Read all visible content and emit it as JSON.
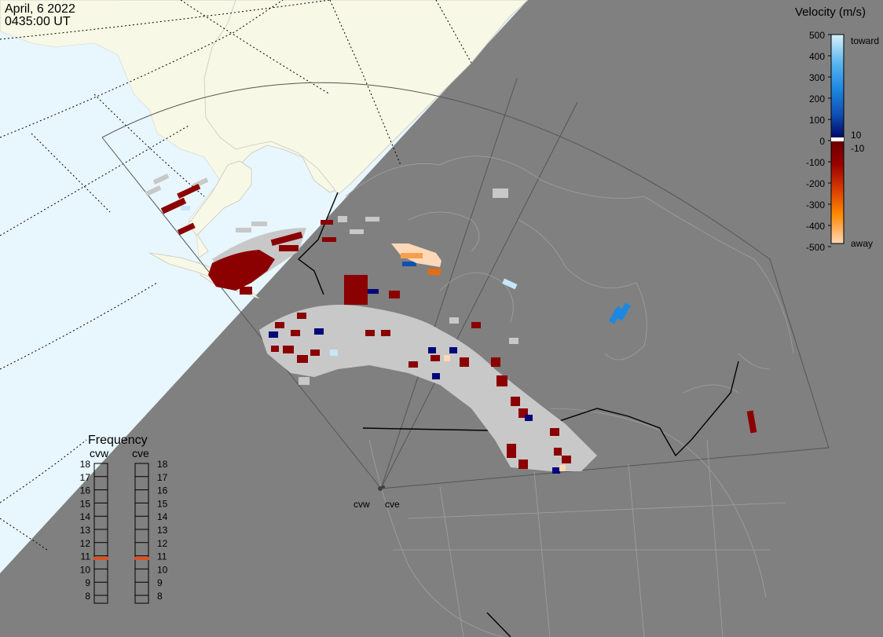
{
  "header": {
    "date": "April, 6 2022",
    "time": "0435:00 UT"
  },
  "colors": {
    "background": "#808080",
    "ocean": "#e8f6fe",
    "land_day": "#f8f8e6",
    "gray_scatter": "#c8c8c8",
    "boundary": "#000000"
  },
  "velocity_legend": {
    "title": "Velocity (m/s)",
    "ticks": [
      "500",
      "400",
      "300",
      "200",
      "100",
      "0",
      "-100",
      "-200",
      "-300",
      "-400",
      "-500"
    ],
    "small_pos": "10",
    "small_neg": "-10",
    "toward_label": "toward",
    "away_label": "away"
  },
  "frequency_legend": {
    "title": "Frequency",
    "radars": [
      {
        "code": "cvw",
        "current_mhz": 10.8
      },
      {
        "code": "cve",
        "current_mhz": 10.8
      }
    ],
    "ticks": [
      "18",
      "17",
      "16",
      "15",
      "14",
      "13",
      "12",
      "11",
      "10",
      "9",
      "8"
    ]
  },
  "radar_sites": {
    "west": "cvw",
    "east": "cve"
  },
  "marker_color": "#e05020"
}
